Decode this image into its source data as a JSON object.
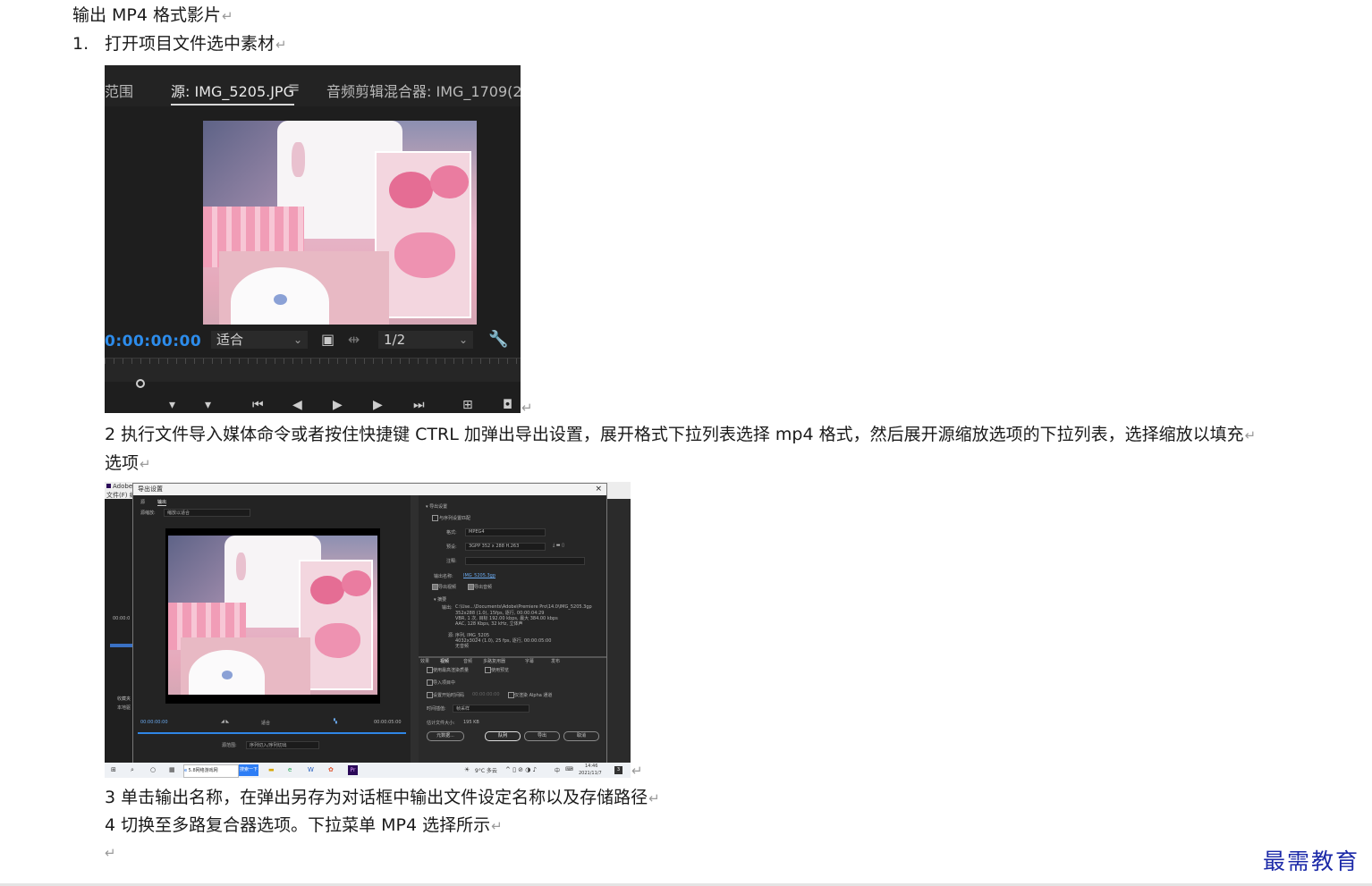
{
  "doc": {
    "heading": "输出 MP4 格式影片",
    "step1_num": "1.",
    "step1_text": "打开项目文件选中素材",
    "step2_line1": "2 执行文件导入媒体命令或者按住快捷键 CTRL 加弹出导出设置，展开格式下拉列表选择 mp4 格式，然后展开源缩放选项的下拉列表，选择缩放以填充",
    "step2_line2": "选项",
    "step3": "3 单击输出名称，在弹出另存为对话框中输出文件设定名称以及存储路径",
    "step4": "4 切换至多路复合器选项。下拉菜单 MP4 选择所示",
    "paragraph_mark": "↵"
  },
  "source_monitor": {
    "tab_left": "范围",
    "tab_source": "源: IMG_5205.JPG",
    "tab_menu": "≡",
    "tab_mixer": "音频剪辑混合器: IMG_1709(20",
    "timecode": "0:00:00:00",
    "fit_label": "适合",
    "resolution": "1/2"
  },
  "export_dialog": {
    "app_title": "Adobe P",
    "app_menu": "文件(F)  编辑",
    "dialog_title": "导出设置",
    "close": "×",
    "tab_source": "源",
    "tab_output": "输出",
    "source_scaling_label": "源缩放:",
    "source_scaling_value": "缩放以适合",
    "export_settings": "导出设置",
    "match_sequence": "与序列设置匹配",
    "format_label": "格式:",
    "format_value": "MPEG4",
    "preset_label": "预设:",
    "preset_value": "3GPP 352 x 288 H.263",
    "comments_label": "注释:",
    "output_name_label": "输出名称:",
    "output_name_value": "IMG_5205.3gp",
    "export_video": "导出视频",
    "export_audio": "导出音频",
    "summary_label": "摘要",
    "summary_output_label": "输出:",
    "summary_output_lines": [
      "C:\\Use...\\Documents\\Adobe\\Premiere Pro\\14.0\\IMG_5205.3gp",
      "352x288 (1.0), 15fps, 逐行, 00:00:04:29",
      "VBR, 1 次, 目标 192.00 kbps, 最大 384.00 kbps",
      "AAC, 128 Kbps, 32 kHz, 立体声"
    ],
    "summary_source_label": "源:",
    "summary_source_lines": [
      "序列, IMG_5205",
      "4032x3024 (1.0), 25 fps, 逐行, 00:00:05:00",
      "无音频"
    ],
    "lower_tabs": [
      "效果",
      "视频",
      "音频",
      "多路复用器",
      "字幕",
      "发布"
    ],
    "use_max_render": "使用最高渲染质量",
    "use_preview": "使用预览",
    "import_into_project": "导入项目中",
    "set_start_timecode": "设置开始时间码",
    "start_timecode_value": "00:00:00:00",
    "render_alpha": "仅渲染 Alpha 通道",
    "time_interp_label": "时间插值:",
    "time_interp_value": "帧采样",
    "est_size_label": "估计文件大小:",
    "est_size_value": "195 KB",
    "btn_metadata": "元数据...",
    "btn_queue": "队列",
    "btn_export": "导出",
    "btn_cancel": "取消",
    "timeline_start": "00:00:00:00",
    "timeline_fit": "适合",
    "timeline_end": "00:00:05:00",
    "source_range_label": "源范围:",
    "source_range_value": "序列切入/序列切出",
    "side_left_timecode": "00:00:0",
    "side_collect": "收藏夹",
    "side_local": "本地驱",
    "taskbar_browser": "5.8网络游戏网",
    "taskbar_search": "搜索一下",
    "taskbar_weather": "9°C 多云",
    "taskbar_lang": "中",
    "taskbar_time": "14:46",
    "taskbar_date": "2021/11/7",
    "taskbar_badge": "3"
  },
  "watermark": "最需教育"
}
